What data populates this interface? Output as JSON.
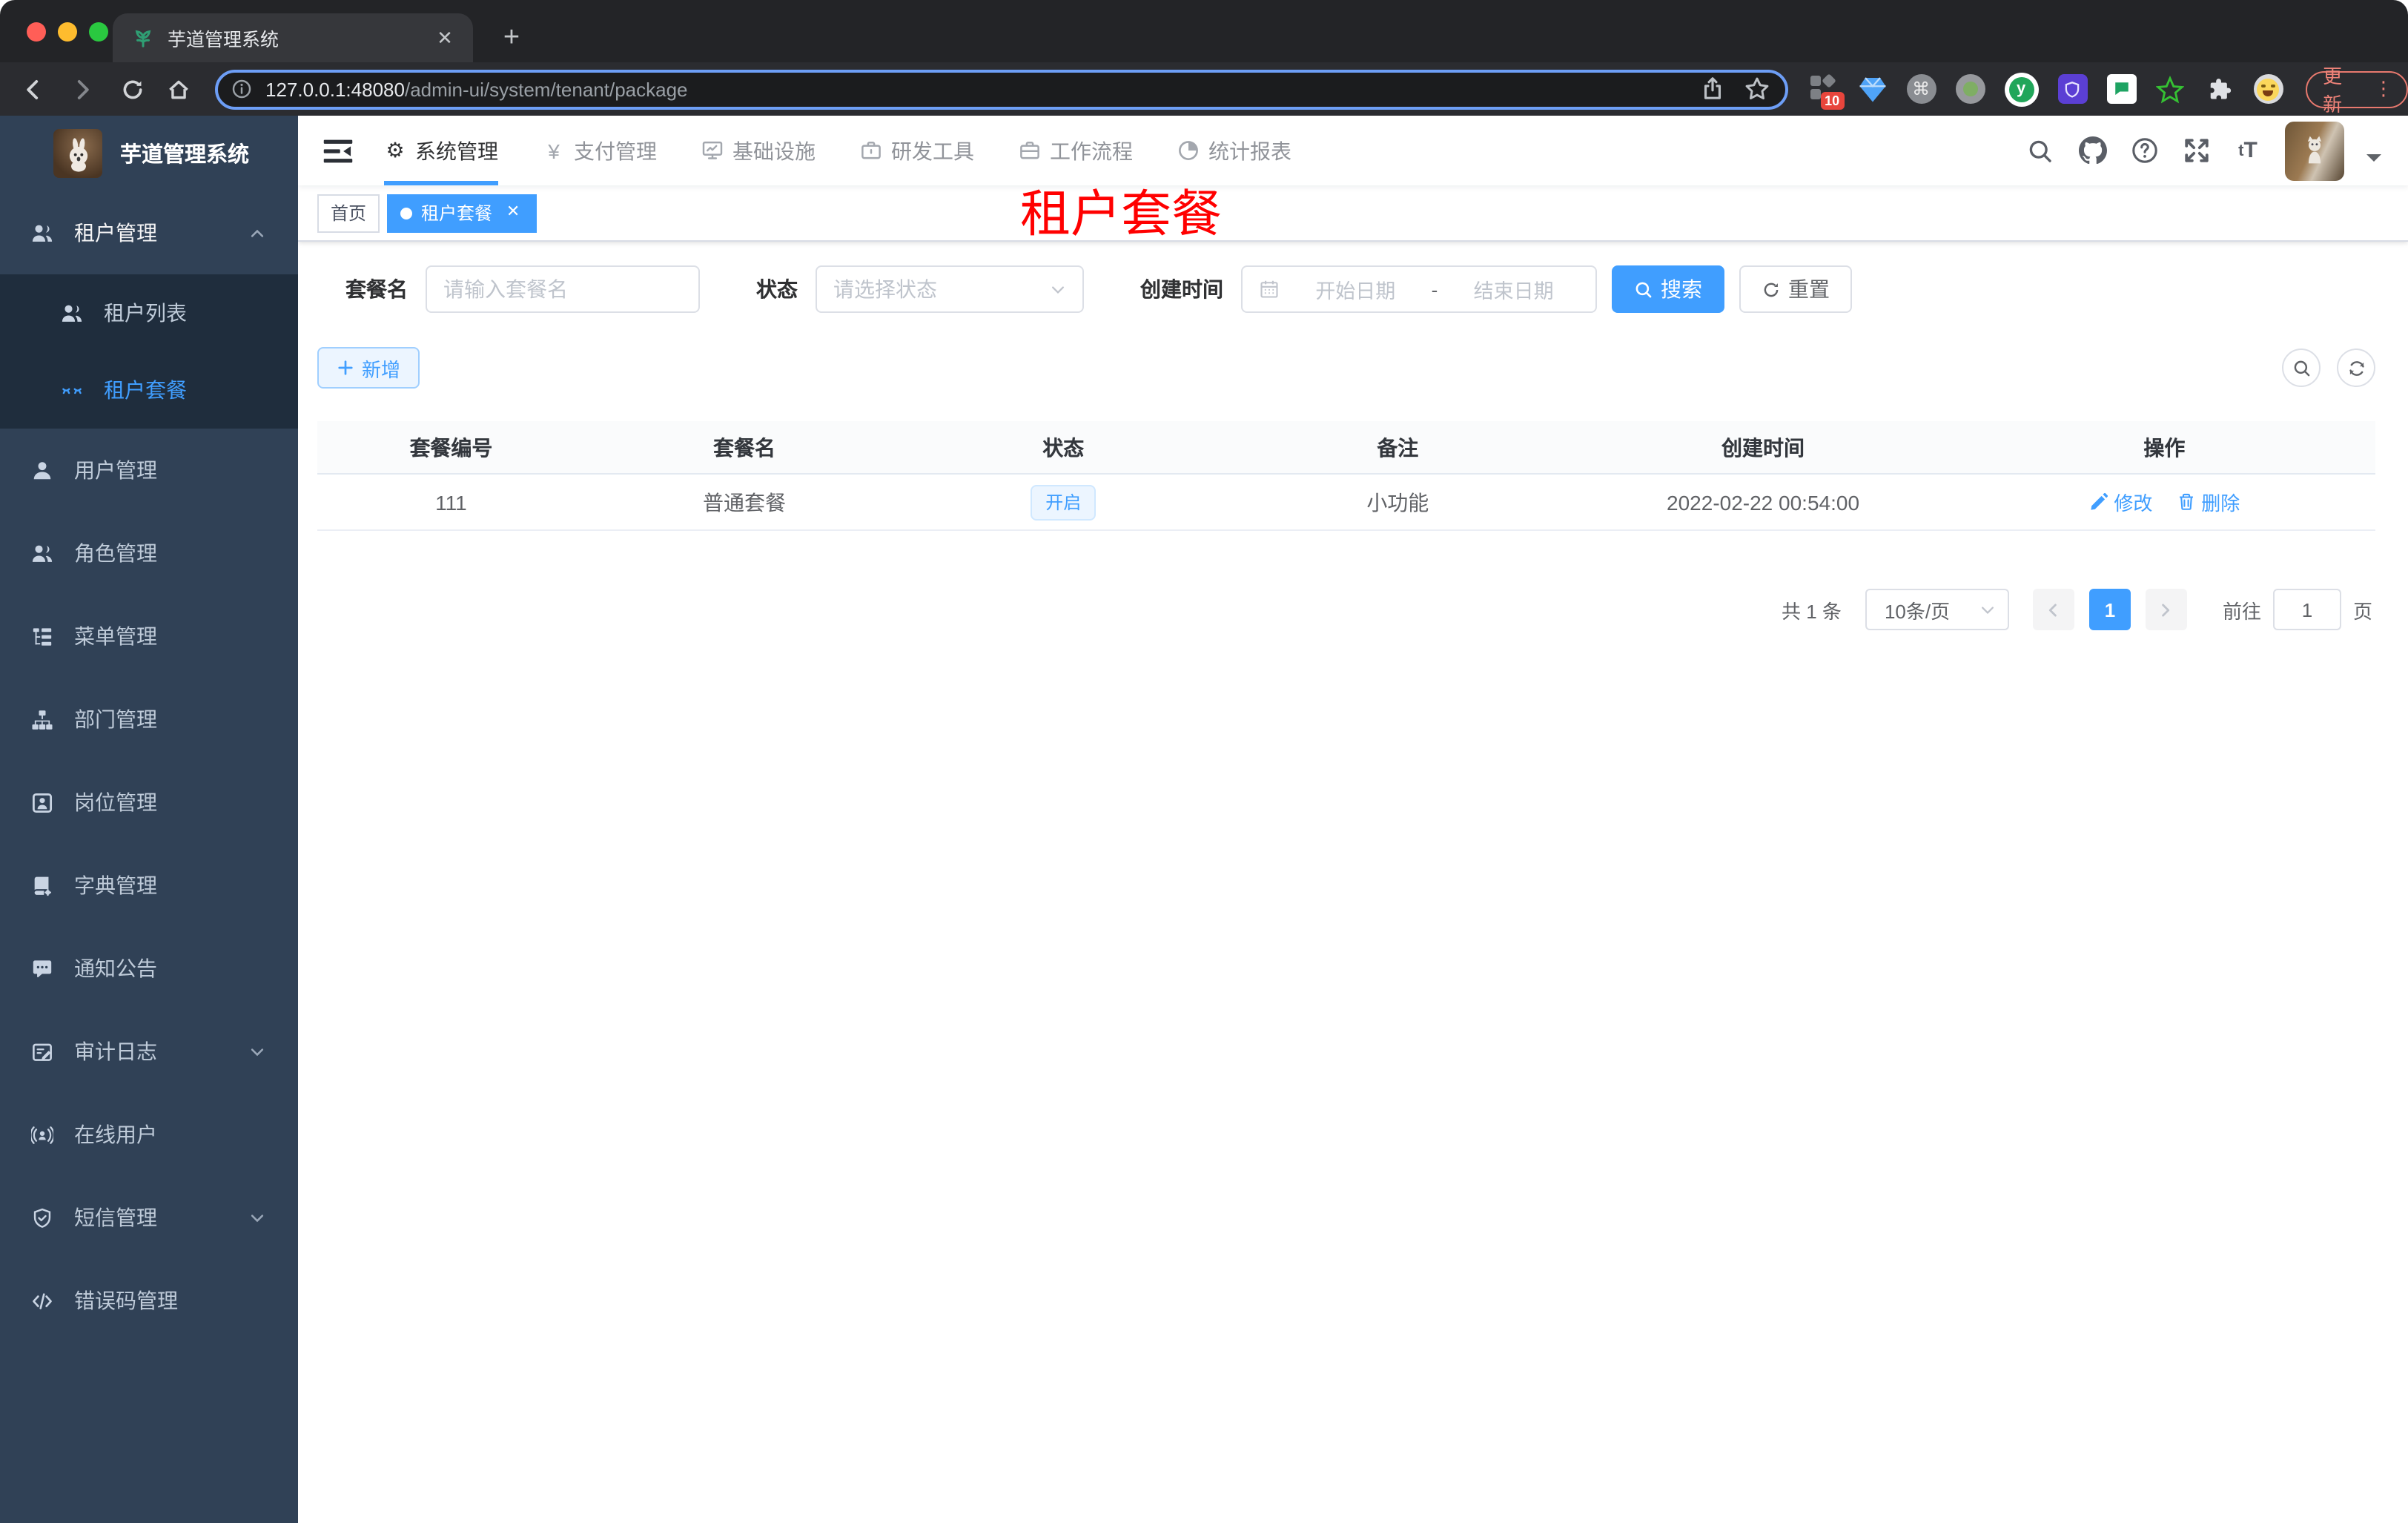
{
  "browser": {
    "tab_title": "芋道管理系统",
    "url_host": "127.0.0.1:48080",
    "url_path": "/admin-ui/system/tenant/package",
    "extension_badge": "10",
    "update_button": "更新"
  },
  "sidebar": {
    "logo_title": "芋道管理系统",
    "items": [
      {
        "label": "租户管理"
      },
      {
        "label": "租户列表"
      },
      {
        "label": "租户套餐"
      },
      {
        "label": "用户管理"
      },
      {
        "label": "角色管理"
      },
      {
        "label": "菜单管理"
      },
      {
        "label": "部门管理"
      },
      {
        "label": "岗位管理"
      },
      {
        "label": "字典管理"
      },
      {
        "label": "通知公告"
      },
      {
        "label": "审计日志"
      },
      {
        "label": "在线用户"
      },
      {
        "label": "短信管理"
      },
      {
        "label": "错误码管理"
      }
    ]
  },
  "topmenu": {
    "items": [
      {
        "label": "系统管理"
      },
      {
        "label": "支付管理"
      },
      {
        "label": "基础设施"
      },
      {
        "label": "研发工具"
      },
      {
        "label": "工作流程"
      },
      {
        "label": "统计报表"
      }
    ]
  },
  "tags": {
    "home": "首页",
    "active": "租户套餐"
  },
  "page_title": "租户套餐",
  "filters": {
    "name_label": "套餐名",
    "name_placeholder": "请输入套餐名",
    "status_label": "状态",
    "status_placeholder": "请选择状态",
    "date_label": "创建时间",
    "date_start_placeholder": "开始日期",
    "date_separator": "-",
    "date_end_placeholder": "结束日期",
    "search_button": "搜索",
    "reset_button": "重置"
  },
  "toolbar": {
    "add_button": "新增"
  },
  "table": {
    "columns": [
      "套餐编号",
      "套餐名",
      "状态",
      "备注",
      "创建时间",
      "操作"
    ],
    "rows": [
      {
        "id": "111",
        "name": "普通套餐",
        "status": "开启",
        "remark": "小功能",
        "created": "2022-02-22 00:54:00",
        "edit": "修改",
        "delete": "删除"
      }
    ]
  },
  "pagination": {
    "total": "共 1 条",
    "page_size": "10条/页",
    "current_page": "1",
    "goto_label": "前往",
    "goto_value": "1",
    "page_unit": "页"
  },
  "colors": {
    "accent": "#409eff",
    "page_title_red": "#ff0000",
    "sidebar_bg": "#304156",
    "submenu_bg": "#1f2d3d",
    "status_tag_bg": "#ecf5ff"
  }
}
